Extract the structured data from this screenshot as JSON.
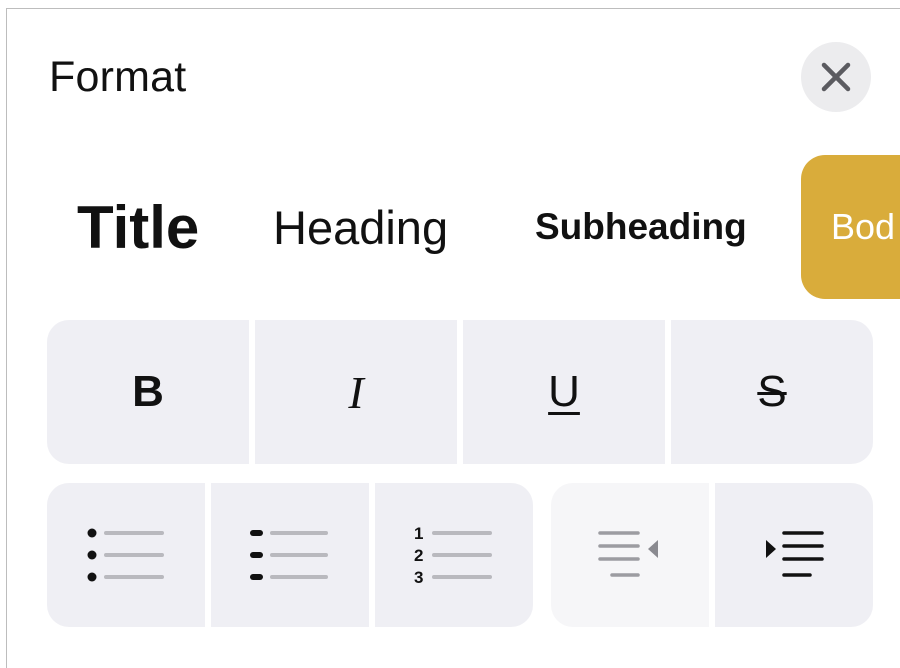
{
  "panel": {
    "title": "Format",
    "close_icon": "close-icon"
  },
  "paragraph_styles": [
    {
      "label": "Title"
    },
    {
      "label": "Heading"
    },
    {
      "label": "Subheading"
    },
    {
      "label": "Bod",
      "selected": true
    }
  ],
  "text_styles": {
    "bold": "B",
    "italic": "I",
    "underline": "U",
    "strikethrough": "S"
  },
  "list_styles": {
    "numbered_labels": [
      "1",
      "2",
      "3"
    ],
    "icons": [
      "bulleted-list-icon",
      "dashed-list-icon",
      "numbered-list-icon"
    ]
  },
  "indent": {
    "icons": [
      "decrease-indent-icon",
      "increase-indent-icon"
    ]
  },
  "colors": {
    "selected_style_bg": "#d9ac3b",
    "button_bg": "#efeff4",
    "close_bg": "#ececee",
    "text": "#111111",
    "line_gray": "#b9b9be"
  }
}
